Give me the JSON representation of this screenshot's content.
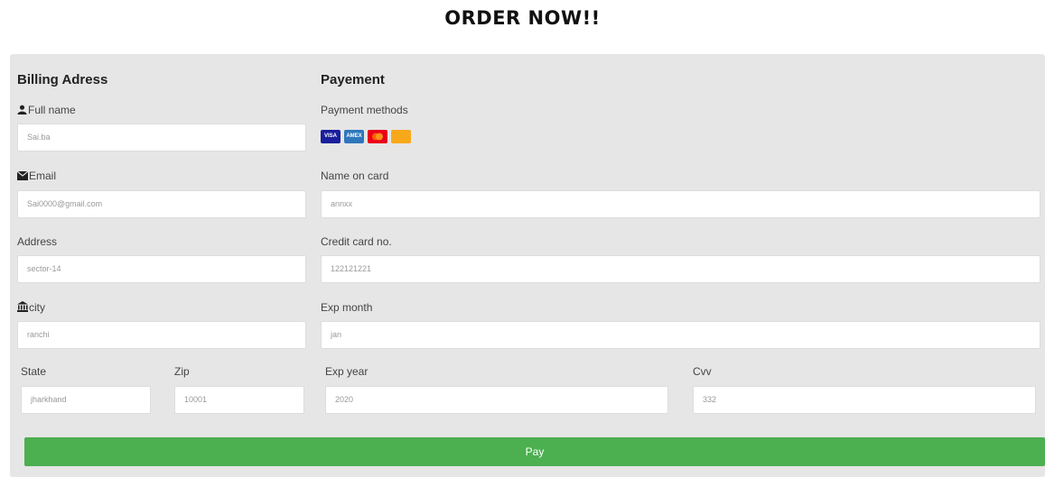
{
  "page_title": "ORDER NOW!!",
  "billing": {
    "heading": "Billing Adress",
    "full_name_label": "Full name",
    "full_name_value": "Sai.ba",
    "email_label": "Email",
    "email_value": "Sai0000@gmail.com",
    "address_label": "Address",
    "address_value": "sector-14",
    "city_label": "city",
    "city_value": "ranchi",
    "state_label": "State",
    "state_value": "jharkhand",
    "zip_label": "Zip",
    "zip_value": "10001"
  },
  "payment": {
    "heading": "Payement",
    "methods_label": "Payment methods",
    "card_icons": [
      "visa-card-icon",
      "amex-card-icon",
      "mastercard-card-icon",
      "discover-card-icon"
    ],
    "name_on_card_label": "Name on card",
    "name_on_card_value": "annxx",
    "card_no_label": "Credit card no.",
    "card_no_value": "122121221",
    "exp_month_label": "Exp month",
    "exp_month_value": "jan",
    "exp_year_label": "Exp year",
    "exp_year_value": "2020",
    "cvv_label": "Cvv",
    "cvv_value": "332"
  },
  "pay_button_label": "Pay",
  "colors": {
    "panel_bg": "#e6e6e6",
    "button_green": "#4caf50",
    "visa_blue": "#1a1f9c",
    "amex_blue": "#2e77bc",
    "mastercard_red": "#eb001b",
    "discover_orange": "#f7a91b"
  }
}
